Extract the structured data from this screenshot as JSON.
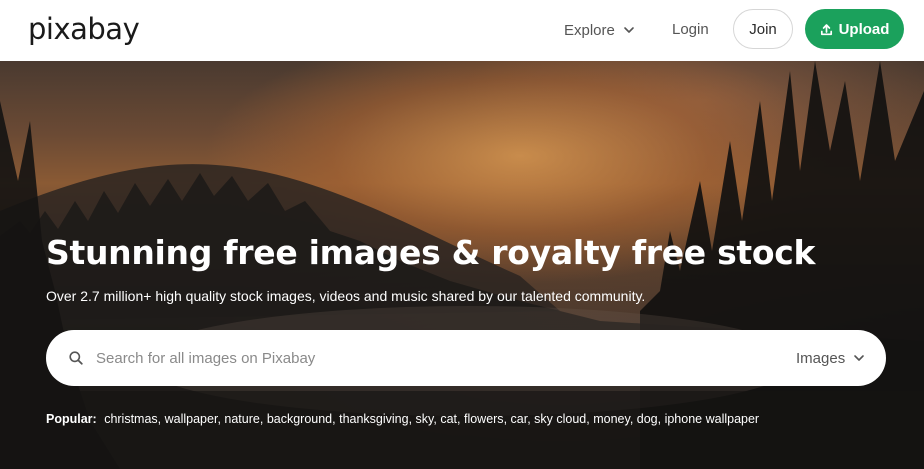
{
  "header": {
    "logo": "pixabay",
    "nav": {
      "explore": "Explore",
      "login": "Login"
    },
    "join_label": "Join",
    "upload_label": "Upload"
  },
  "hero": {
    "title": "Stunning free images & royalty free stock",
    "subtitle": "Over 2.7 million+ high quality stock images, videos and music shared by our talented community."
  },
  "search": {
    "placeholder": "Search for all images on Pixabay",
    "value": "",
    "type_selected": "Images"
  },
  "popular": {
    "label": "Popular:",
    "tags": [
      "christmas",
      "wallpaper",
      "nature",
      "background",
      "thanksgiving",
      "sky",
      "cat",
      "flowers",
      "car",
      "sky cloud",
      "money",
      "dog",
      "iphone wallpaper"
    ]
  },
  "colors": {
    "accent": "#1ba15c",
    "nav_text": "#555555",
    "hero_text": "#ffffff"
  },
  "icons": {
    "explore": "chevron-down-icon",
    "upload": "upload-icon",
    "search": "search-icon",
    "type_select": "chevron-down-icon"
  }
}
